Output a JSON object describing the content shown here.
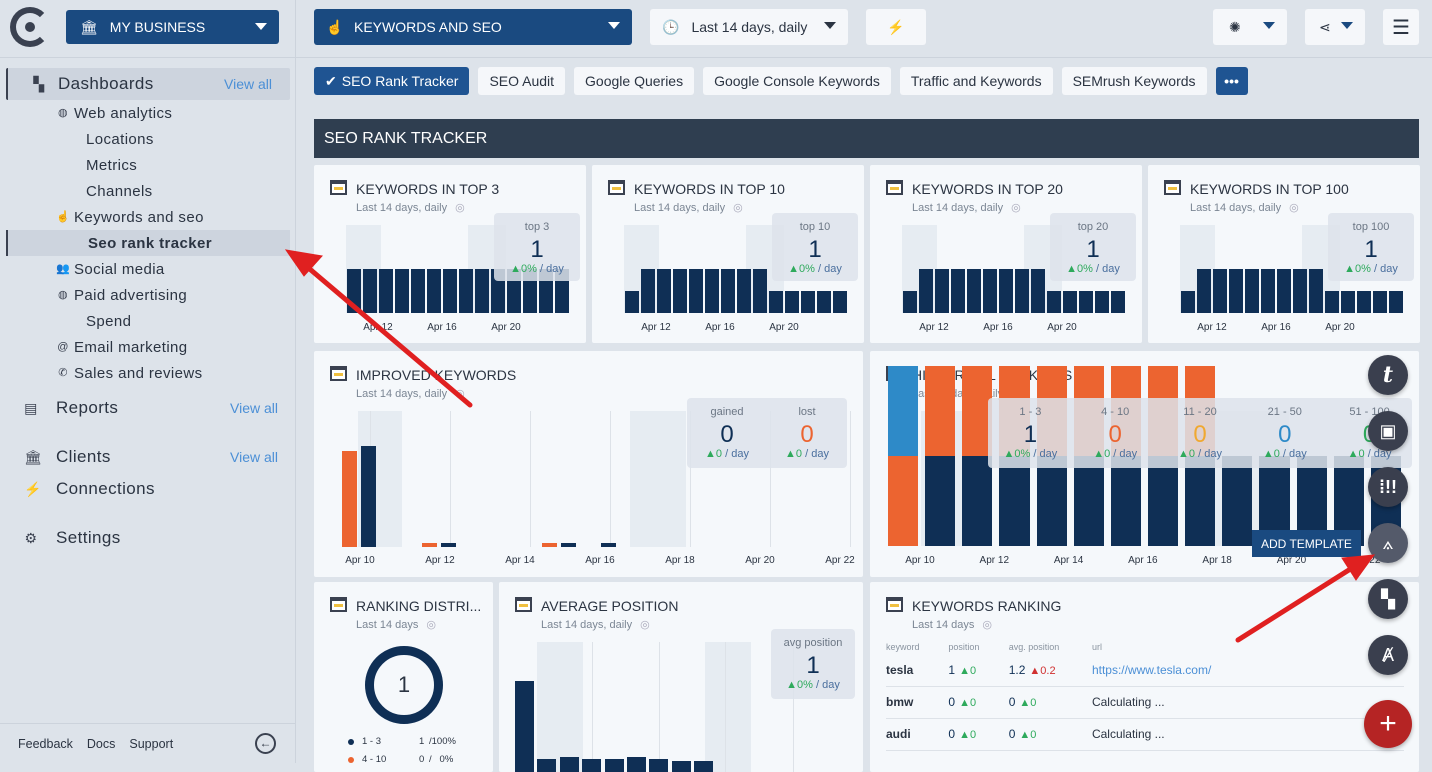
{
  "app": {
    "business": "MY BUSINESS",
    "dashboard": "KEYWORDS AND SEO",
    "date_range": "Last 14 days, daily"
  },
  "colors": {
    "navy": "#0f2f55",
    "orange": "#ec6430",
    "blue": "#2e8ac8",
    "yellow": "#f0a830",
    "green": "#2eaa5c",
    "accent": "#1a4a80",
    "fab_red": "#b52424"
  },
  "sidebar": {
    "dashboards": "Dashboards",
    "view_all": "View all",
    "items": [
      {
        "label": "Web analytics",
        "level": 2,
        "icon": "globe-icon"
      },
      {
        "label": "Locations",
        "level": 3
      },
      {
        "label": "Metrics",
        "level": 3
      },
      {
        "label": "Channels",
        "level": 3
      },
      {
        "label": "Keywords and seo",
        "level": 2,
        "icon": "touch-icon"
      },
      {
        "label": "Seo rank tracker",
        "level": 3,
        "current": true
      },
      {
        "label": "Social media",
        "level": 2,
        "icon": "people-icon"
      },
      {
        "label": "Paid advertising",
        "level": 2,
        "icon": "globe-icon"
      },
      {
        "label": "Spend",
        "level": 3
      },
      {
        "label": "Email marketing",
        "level": 2,
        "icon": "at-icon"
      },
      {
        "label": "Sales and reviews",
        "level": 2,
        "icon": "phone-icon"
      }
    ],
    "reports": "Reports",
    "clients": "Clients",
    "connections": "Connections",
    "settings": "Settings",
    "footer": {
      "feedback": "Feedback",
      "docs": "Docs",
      "support": "Support"
    }
  },
  "tabs": [
    "SEO Rank Tracker",
    "SEO Audit",
    "Google Queries",
    "Google Console Keywords",
    "Traffic and Keywords",
    "SEMrush Keywords"
  ],
  "tabs_more": "•••",
  "section_title": "SEO RANK TRACKER",
  "top_cards": [
    {
      "title": "KEYWORDS IN TOP 3",
      "subtitle": "Last 14 days, daily",
      "stat_label": "top 3",
      "stat_value": "1",
      "delta": "▲0%",
      "per": " / day",
      "values": [
        1,
        1,
        1,
        1,
        1,
        1,
        1,
        1,
        1,
        1,
        1,
        1,
        1,
        1
      ],
      "ymax": 2,
      "ticks": [
        {
          "i": 1.5,
          "label": "Apr 12"
        },
        {
          "i": 5.5,
          "label": "Apr 16"
        },
        {
          "i": 9.5,
          "label": "Apr 20"
        }
      ]
    },
    {
      "title": "KEYWORDS IN TOP 10",
      "subtitle": "Last 14 days, daily",
      "stat_label": "top 10",
      "stat_value": "1",
      "delta": "▲0%",
      "per": " / day",
      "values": [
        1,
        2,
        2,
        2,
        2,
        2,
        2,
        2,
        2,
        1,
        1,
        1,
        1,
        1
      ],
      "ymax": 4,
      "ticks": [
        {
          "i": 1.5,
          "label": "Apr 12"
        },
        {
          "i": 5.5,
          "label": "Apr 16"
        },
        {
          "i": 9.5,
          "label": "Apr 20"
        }
      ]
    },
    {
      "title": "KEYWORDS IN TOP 20",
      "subtitle": "Last 14 days, daily",
      "stat_label": "top 20",
      "stat_value": "1",
      "delta": "▲0%",
      "per": " / day",
      "values": [
        1,
        2,
        2,
        2,
        2,
        2,
        2,
        2,
        2,
        1,
        1,
        1,
        1,
        1
      ],
      "ymax": 4,
      "ticks": [
        {
          "i": 1.5,
          "label": "Apr 12"
        },
        {
          "i": 5.5,
          "label": "Apr 16"
        },
        {
          "i": 9.5,
          "label": "Apr 20"
        }
      ]
    },
    {
      "title": "KEYWORDS IN TOP 100",
      "subtitle": "Last 14 days, daily",
      "stat_label": "top 100",
      "stat_value": "1",
      "delta": "▲0%",
      "per": " / day",
      "values": [
        1,
        2,
        2,
        2,
        2,
        2,
        2,
        2,
        2,
        1,
        1,
        1,
        1,
        1
      ],
      "ymax": 4,
      "ticks": [
        {
          "i": 1.5,
          "label": "Apr 12"
        },
        {
          "i": 5.5,
          "label": "Apr 16"
        },
        {
          "i": 9.5,
          "label": "Apr 20"
        }
      ]
    }
  ],
  "improved": {
    "title": "IMPROVED KEYWORDS",
    "subtitle": "Last 14 days, daily",
    "stats": [
      {
        "label": "gained",
        "value": "0",
        "delta": "▲0",
        "per": " / day",
        "color": "#0f2f55"
      },
      {
        "label": "lost",
        "value": "0",
        "delta": "▲0",
        "per": " / day",
        "color": "#ec6430"
      }
    ],
    "chart_data": {
      "type": "bar",
      "categories": [
        "Apr 10",
        "Apr 11",
        "Apr 12",
        "Apr 13",
        "Apr 14",
        "Apr 15",
        "Apr 16",
        "Apr 17",
        "Apr 18",
        "Apr 19",
        "Apr 20",
        "Apr 21",
        "Apr 22"
      ],
      "series": [
        {
          "name": "lost",
          "values": [
            0.95,
            0,
            0.03,
            0,
            0,
            0.03,
            0,
            0,
            0,
            0,
            0,
            0,
            0
          ]
        },
        {
          "name": "gained",
          "values": [
            1,
            0,
            0.03,
            0,
            0,
            0.03,
            0.03,
            0,
            0,
            0,
            0,
            0,
            0
          ]
        }
      ],
      "ymax": 1.35,
      "ticks": [
        "Apr 10",
        "Apr 12",
        "Apr 14",
        "Apr 16",
        "Apr 18",
        "Apr 20",
        "Apr 22"
      ]
    }
  },
  "historical": {
    "title": "HISTORICAL RANKINGS",
    "subtitle": "Last 14 days, daily",
    "stats": [
      {
        "label": "1 - 3",
        "value": "1",
        "delta": "▲0%",
        "per": " / day",
        "color": "#0f2f55"
      },
      {
        "label": "4 - 10",
        "value": "0",
        "delta": "▲0",
        "per": " / day",
        "color": "#ec6430"
      },
      {
        "label": "11 - 20",
        "value": "0",
        "delta": "▲0",
        "per": " / day",
        "color": "#f0a830"
      },
      {
        "label": "21 - 50",
        "value": "0",
        "delta": "▲0",
        "per": " / day",
        "color": "#2e8ac8"
      },
      {
        "label": "51 - 100",
        "value": "0",
        "delta": "▲0",
        "per": " / day",
        "color": "#2eaa5c"
      }
    ],
    "chart_data": {
      "type": "bar",
      "stacked": true,
      "ticks": [
        "Apr 10",
        "Apr 12",
        "Apr 14",
        "Apr 16",
        "Apr 18",
        "Apr 20",
        "Apr 22"
      ],
      "series": [
        {
          "name": "1 - 3",
          "color": "#0f2f55",
          "values": [
            0,
            1,
            1,
            1,
            1,
            1,
            1,
            1,
            1,
            1,
            1,
            1,
            1,
            1
          ]
        },
        {
          "name": "4 - 10",
          "color": "#ec6430",
          "values": [
            1,
            1,
            1,
            1,
            1,
            1,
            1,
            1,
            1,
            0,
            0,
            0,
            0,
            0
          ]
        },
        {
          "name": "21 - 50",
          "color": "#2e8ac8",
          "values": [
            1,
            0,
            0,
            0,
            0,
            0,
            0,
            0,
            0,
            0,
            0,
            0,
            0,
            0
          ]
        }
      ],
      "ymax": 2
    }
  },
  "distribution": {
    "title": "RANKING DISTRI...",
    "subtitle": "Last 14 days",
    "center": "1",
    "legend": [
      {
        "label": "1 - 3",
        "count": "1",
        "pct": "/100%",
        "color": "#0f2f55"
      },
      {
        "label": "4 - 10",
        "count": "0",
        "pct": "/   0%",
        "color": "#ec6430"
      }
    ]
  },
  "avgpos": {
    "title": "AVERAGE POSITION",
    "subtitle": "Last 14 days, daily",
    "stat_label": "avg position",
    "stat_value": "1",
    "delta": "▲0%",
    "per": " / day",
    "chart_data": {
      "type": "bar",
      "values": [
        1,
        0.14,
        0.16,
        0.14,
        0.14,
        0.16,
        0.14,
        0.12,
        0.12
      ]
    }
  },
  "ranking": {
    "title": "KEYWORDS RANKING",
    "subtitle": "Last 14 days",
    "columns": [
      "keyword",
      "position",
      "avg. position",
      "url"
    ],
    "rows": [
      {
        "keyword": "tesla",
        "position": "1",
        "pos_delta": "▲0",
        "avg": "1.2",
        "avg_delta": "▲0.2",
        "avg_down": true,
        "url": "https://www.tesla.com/"
      },
      {
        "keyword": "bmw",
        "position": "0",
        "pos_delta": "▲0",
        "avg": "0",
        "avg_delta": "▲0",
        "url": "Calculating ..."
      },
      {
        "keyword": "audi",
        "position": "0",
        "pos_delta": "▲0",
        "avg": "0",
        "avg_delta": "▲0",
        "url": "Calculating ..."
      }
    ]
  },
  "fab": {
    "tooltip": "ADD TEMPLATE",
    "text_label": "t",
    "plus": "+"
  }
}
